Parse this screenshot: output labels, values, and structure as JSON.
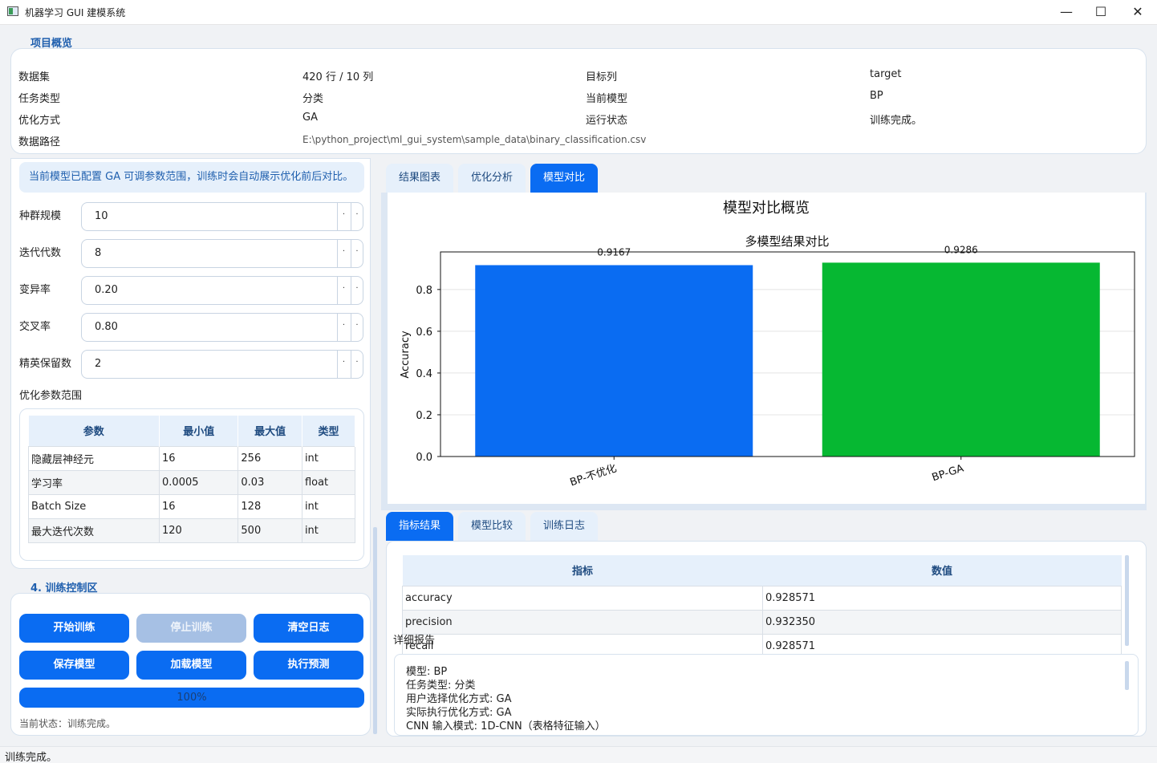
{
  "window": {
    "title": "机器学习 GUI 建模系统",
    "minimize": "—",
    "maximize": "☐",
    "close": "✕"
  },
  "overview": {
    "section_title": "项目概览",
    "rows": [
      {
        "k1": "数据集",
        "v1": "420 行 / 10 列",
        "k2": "目标列",
        "v2": "target"
      },
      {
        "k1": "任务类型",
        "v1": "分类",
        "k2": "当前模型",
        "v2": "BP"
      },
      {
        "k1": "优化方式",
        "v1": "GA",
        "k2": "运行状态",
        "v2": "训练完成。"
      }
    ],
    "path_label": "数据路径",
    "path_value": "E:\\python_project\\ml_gui_system\\sample_data\\binary_classification.csv"
  },
  "ga_config": {
    "note": "当前模型已配置 GA 可调参数范围，训练时会自动展示优化前后对比。",
    "params": [
      {
        "label": "种群规模",
        "value": "10"
      },
      {
        "label": "迭代代数",
        "value": "8"
      },
      {
        "label": "变异率",
        "value": "0.20"
      },
      {
        "label": "交叉率",
        "value": "0.80"
      },
      {
        "label": "精英保留数",
        "value": "2"
      }
    ],
    "spin_up": "·",
    "spin_down": "·",
    "range_label": "优化参数范围",
    "range_table": {
      "headers": [
        "参数",
        "最小值",
        "最大值",
        "类型"
      ],
      "rows": [
        [
          "隐藏层神经元",
          "16",
          "256",
          "int"
        ],
        [
          "学习率",
          "0.0005",
          "0.03",
          "float"
        ],
        [
          "Batch Size",
          "16",
          "128",
          "int"
        ],
        [
          "最大迭代次数",
          "120",
          "500",
          "int"
        ]
      ]
    }
  },
  "controls": {
    "section_title": "4. 训练控制区",
    "buttons": {
      "start": "开始训练",
      "stop": "停止训练",
      "clear_log": "清空日志",
      "save_model": "保存模型",
      "load_model": "加载模型",
      "predict": "执行预测"
    },
    "progress": 1.0,
    "progress_text": "100%",
    "status": "当前状态：训练完成。"
  },
  "top_tabs": [
    "结果图表",
    "优化分析",
    "模型对比"
  ],
  "top_tab_active": 2,
  "chart_data": {
    "type": "bar",
    "suptitle": "模型对比概览",
    "title": "多模型结果对比",
    "categories": [
      "BP-不优化",
      "BP-GA"
    ],
    "values": [
      0.9167,
      0.9286
    ],
    "value_labels": [
      "0.9167",
      "0.9286"
    ],
    "colors": [
      "#0a6cf2",
      "#06b832"
    ],
    "xlabel": "",
    "ylabel": "Accuracy",
    "ylim": [
      0,
      0.98
    ],
    "yticks": [
      0.0,
      0.2,
      0.4,
      0.6,
      0.8
    ],
    "ytick_labels": [
      "0.0",
      "0.2",
      "0.4",
      "0.6",
      "0.8"
    ],
    "grid": "y"
  },
  "bottom_tabs": [
    "指标结果",
    "模型比较",
    "训练日志"
  ],
  "bottom_tab_active": 0,
  "metrics": {
    "headers": [
      "指标",
      "数值"
    ],
    "rows": [
      [
        "accuracy",
        "0.928571"
      ],
      [
        "precision",
        "0.932350"
      ],
      [
        "recall",
        "0.928571"
      ]
    ]
  },
  "report": {
    "title": "详细报告",
    "lines": [
      "模型: BP",
      "任务类型: 分类",
      "用户选择优化方式: GA",
      "实际执行优化方式: GA",
      "CNN 输入模式: 1D-CNN（表格特征输入）"
    ]
  },
  "statusbar": "训练完成。"
}
